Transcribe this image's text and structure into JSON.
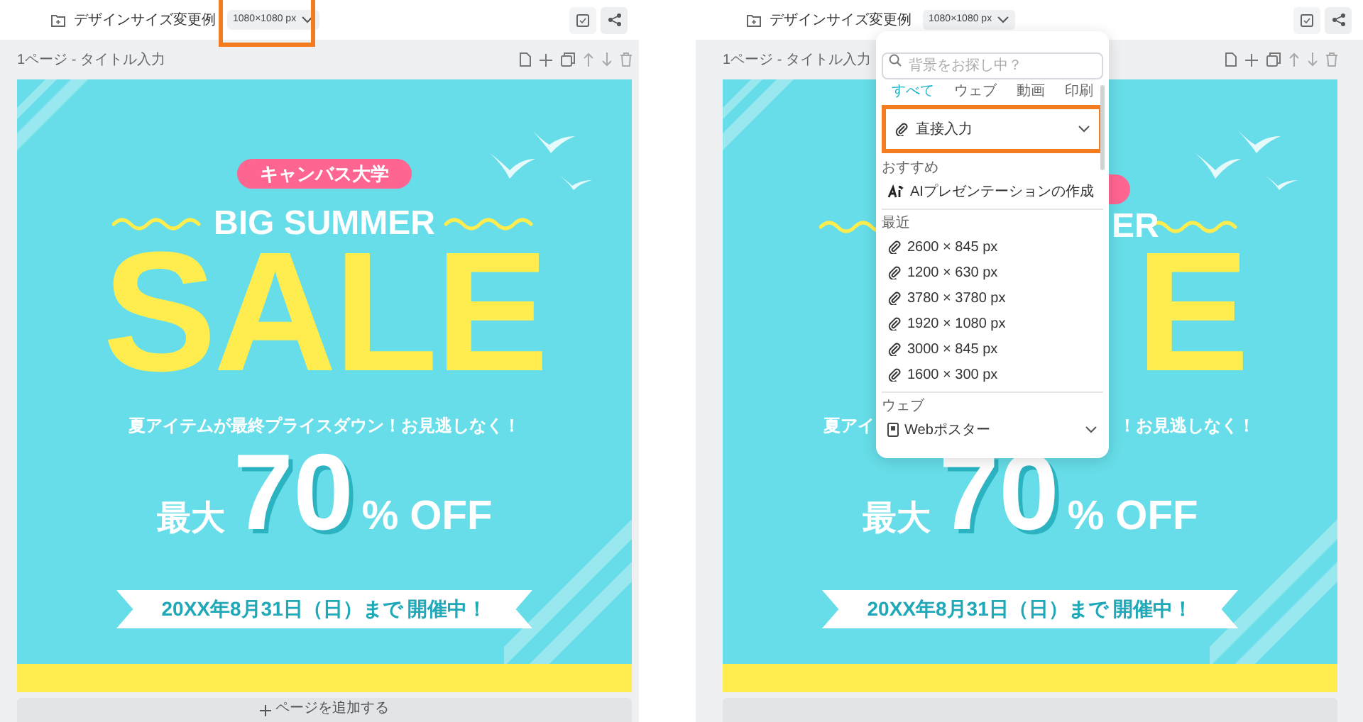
{
  "panels": [
    {
      "header": {
        "title": "デザインサイズ変更例",
        "size": "1080×1080 px",
        "size_highlighted": true
      },
      "page_label": "1ページ - タイトル入力",
      "poster": {
        "badge": "キャンバス大学",
        "headline": "BIG SUMMER",
        "title": "SALE",
        "subtitle": "夏アイテムが最終プライスダウン！お見逃しなく！",
        "max_label": "最大",
        "discount": "70",
        "discount_unit": "% OFF",
        "date_banner": "20XX年8月31日（日）まで 開催中！"
      },
      "add_page": "ページを追加する"
    },
    {
      "header": {
        "title": "デザインサイズ変更例",
        "size": "1080×1080 px",
        "size_highlighted": false
      },
      "page_label": "1ページ - タイトル入力",
      "poster": {
        "headline_fragment": "ER",
        "title_fragment": "E",
        "subtitle_fragments": [
          "夏アイ",
          "！お見逃しなく！"
        ],
        "max_label": "最大",
        "discount": "70",
        "discount_unit": "% OFF",
        "date_banner": "20XX年8月31日（日）まで 開催中！"
      },
      "dropdown": {
        "search_placeholder": "背景をお探し中？",
        "tabs": [
          {
            "label": "すべて",
            "selected": true
          },
          {
            "label": "ウェブ",
            "selected": false
          },
          {
            "label": "動画",
            "selected": false
          },
          {
            "label": "印刷",
            "selected": false
          }
        ],
        "direct_input": {
          "label": "直接入力",
          "highlighted": true
        },
        "sections": [
          {
            "title": "おすすめ",
            "items": [
              {
                "label": "AIプレゼンテーションの作成",
                "kind": "ai"
              }
            ]
          },
          {
            "title": "最近",
            "items": [
              {
                "label": "2600 × 845 px",
                "kind": "size"
              },
              {
                "label": "1200 × 630 px",
                "kind": "size"
              },
              {
                "label": "3780 × 3780 px",
                "kind": "size"
              },
              {
                "label": "1920 × 1080 px",
                "kind": "size"
              },
              {
                "label": "3000 × 845 px",
                "kind": "size"
              },
              {
                "label": "1600 × 300 px",
                "kind": "size"
              }
            ]
          },
          {
            "title": "ウェブ",
            "items": [
              {
                "label": "Webポスター",
                "kind": "category"
              }
            ]
          }
        ]
      }
    }
  ]
}
